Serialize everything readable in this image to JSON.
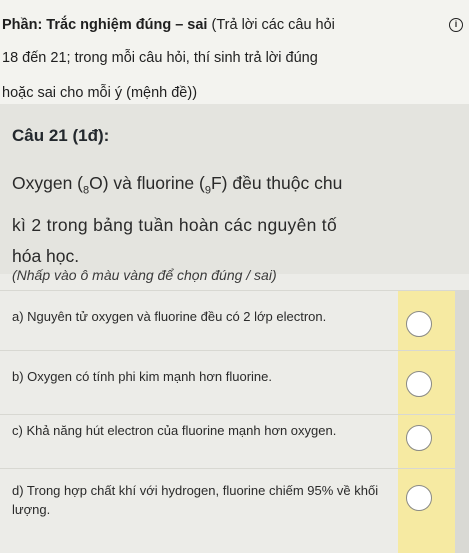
{
  "header": {
    "line1_bold": "Phần: Trắc nghiệm đúng – sai",
    "line1_rest": " (Trả lời các câu hỏi",
    "line2": "18 đến 21; trong mỗi câu hỏi, thí sinh trả lời đúng",
    "line3": "hoặc sai cho mỗi ý (mệnh đề))",
    "info_icon": "info-icon",
    "info_glyph": "i"
  },
  "question": {
    "title": "Câu 21 (1đ):",
    "line1_a": "Oxygen (",
    "line1_sub1": "8",
    "line1_b": "O) và fluorine (",
    "line1_sub2": "9",
    "line1_c": "F) đều thuộc chu",
    "line2": "kì 2 trong bảng tuần hoàn các nguyên tố",
    "line3": "hóa học."
  },
  "hint": "(Nhấp vào ô màu vàng để chọn đúng / sai)",
  "statements": [
    {
      "text": "a) Nguyên tử oxygen và fluorine đều có 2 lớp electron."
    },
    {
      "text": "b) Oxygen có tính phi kim mạnh hơn fluorine."
    },
    {
      "text": "c) Khả năng hút electron của fluorine mạnh hơn oxygen."
    },
    {
      "text": "d) Trong hợp chất khí với hydrogen, fluorine chiếm 95% về khối lượng."
    }
  ],
  "colors": {
    "answer_cell": "#f6eaa2",
    "background": "#e9e9e4"
  }
}
